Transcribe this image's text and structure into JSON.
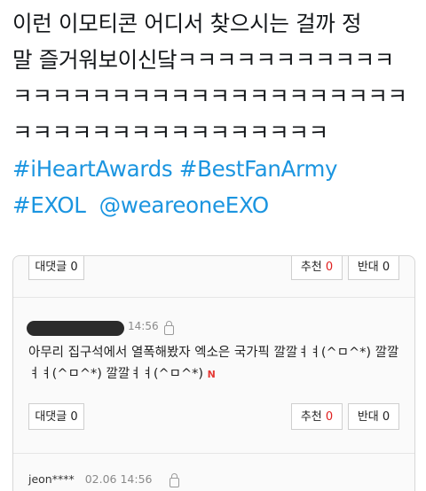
{
  "tweet": {
    "line1": "이런 이모티콘 어디서 찾으시는 걸까 정",
    "line2": "말 즐거워보이신닼ㅋㅋㅋㅋㅋㅋㅋㅋㅋㅋㅋ",
    "line3": "ㅋㅋㅋㅋㅋㅋㅋㅋㅋㅋㅋㅋㅋㅋㅋㅋㅋㅋㅋㅋ",
    "line4": "ㅋㅋㅋㅋㅋㅋㅋㅋㅋㅋㅋㅋㅋㅋㅋㅋ",
    "hashtags_line1": "#iHeartAwards #BestFanArmy",
    "hashtag_exol": "#EXOL",
    "mention": "@weareoneEXO"
  },
  "comments_card": {
    "top_row": {
      "reply_label": "대댓글",
      "reply_count": "0",
      "up_label": "추천",
      "up_count": "0",
      "down_label": "반대",
      "down_count": "0"
    },
    "comment": {
      "time": "14:56",
      "text": "아무리 집구석에서 열폭해봤자 엑소은 국가픽 깔깔ㅕㅕ(^ㅁ^*) 깔깔ㅕㅕ(^ㅁ^*) 깔깔ㅕㅕ(^ㅁ^*)",
      "new_badge": "N",
      "reply_label": "대댓글",
      "reply_count": "0",
      "up_label": "추천",
      "up_count": "0",
      "down_label": "반대",
      "down_count": "0"
    },
    "next_comment": {
      "user": "jeon****",
      "time": "02.06 14:56"
    }
  }
}
